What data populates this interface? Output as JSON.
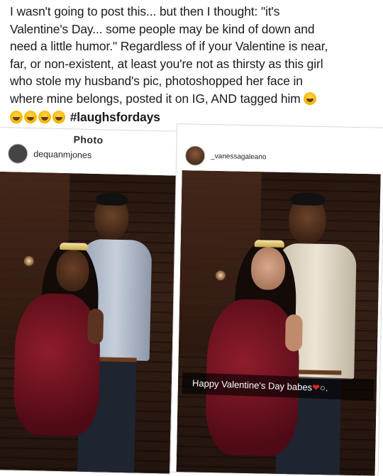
{
  "post": {
    "lines": [
      "I wasn't going to post this... but then I thought: \"it's",
      "Valentine's Day... some people may be kind of down and",
      "need a little humor.\" Regardless of if your Valentine is near,",
      "far, or non-existent, at least you're not as thirsty as this girl",
      "who stole my husband's pic, photoshopped her face in",
      "where mine belongs, posted it on IG, AND tagged him"
    ],
    "hashtag": "#laughsfordays",
    "emoji_icon": "laughing-crying-emoji"
  },
  "left_screenshot": {
    "header_title": "Photo",
    "username": "dequanmjones"
  },
  "right_screenshot": {
    "username": "_vanessagaleano",
    "caption": "Happy Valentine's Day babes",
    "caption_icons": [
      "heart-icon",
      "ring-icon"
    ]
  },
  "colors": {
    "heart": "#e0242b",
    "dress": "#7a1423",
    "background_brick": "#3a2218"
  }
}
